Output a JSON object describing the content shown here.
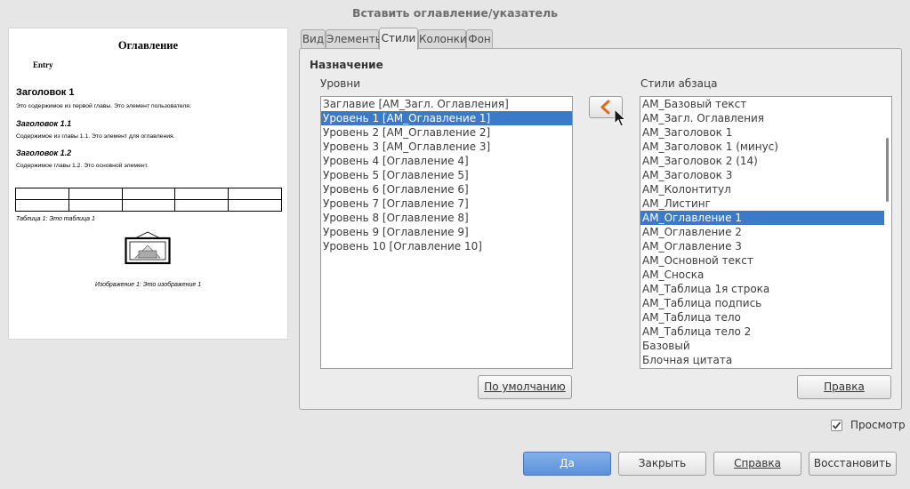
{
  "window": {
    "title": "Вставить оглавление/указатель"
  },
  "preview": {
    "title": "Оглавление",
    "entry": "Entry",
    "heading1": "Заголовок 1",
    "text1": "Это содержимое из первой главы. Это элемент пользователя.",
    "heading11": "Заголовок 1.1",
    "text11": "Содержимое из главы 1.1. Это элемент для оглавления.",
    "heading12": "Заголовок 1.2",
    "text12": "Содержимое главы 1.2. Это основной элемент.",
    "table_caption": "Таблица 1: Это таблица 1",
    "image_caption": "Изображение 1: Это изображение 1"
  },
  "tabs": [
    {
      "label": "Вид",
      "active": false
    },
    {
      "label": "Элементы",
      "active": false
    },
    {
      "label": "Стили",
      "active": true
    },
    {
      "label": "Колонки",
      "active": false
    },
    {
      "label": "Фон",
      "active": false
    }
  ],
  "assignment": {
    "legend": "Назначение",
    "levels_label": "Уровни",
    "styles_label": "Стили абзаца",
    "levels": [
      "Заглавие [АМ_Загл. Оглавления]",
      "Уровень 1 [АМ_Оглавление 1]",
      "Уровень 2 [АМ_Оглавление 2]",
      "Уровень 3 [АМ_Оглавление 3]",
      "Уровень 4 [Оглавление 4]",
      "Уровень 5 [Оглавление 5]",
      "Уровень 6 [Оглавление 6]",
      "Уровень 7 [Оглавление 7]",
      "Уровень 8 [Оглавление 8]",
      "Уровень 9 [Оглавление 9]",
      "Уровень 10 [Оглавление 10]"
    ],
    "levels_selected": 1,
    "paragraph_styles": [
      "АМ_Базовый текст",
      "АМ_Загл. Оглавления",
      "АМ_Заголовок 1",
      "АМ_Заголовок 1 (минус)",
      "АМ_Заголовок 2 (14)",
      "АМ_Заголовок 3",
      "АМ_Колонтитул",
      "АМ_Листинг",
      "АМ_Оглавление 1",
      "АМ_Оглавление 2",
      "АМ_Оглавление 3",
      "АМ_Основной текст",
      "АМ_Сноска",
      "АМ_Таблица 1я строка",
      "АМ_Таблица подпись",
      "АМ_Таблица тело",
      "АМ_Таблица тело 2",
      "Базовый",
      "Блочная цитата"
    ],
    "styles_selected": 8,
    "default_button": "По умолчанию",
    "edit_button": "Правка",
    "assign_icon": "chevron-left-icon"
  },
  "preview_checkbox": {
    "label": "Просмотр",
    "checked": true
  },
  "footer": {
    "ok": "Да",
    "close": "Закрыть",
    "help": "Справка",
    "reset": "Восстановить"
  },
  "colors": {
    "selection": "#3d79c9",
    "default_button": "#5b91db",
    "accent_arrow": "#e06a1b"
  }
}
